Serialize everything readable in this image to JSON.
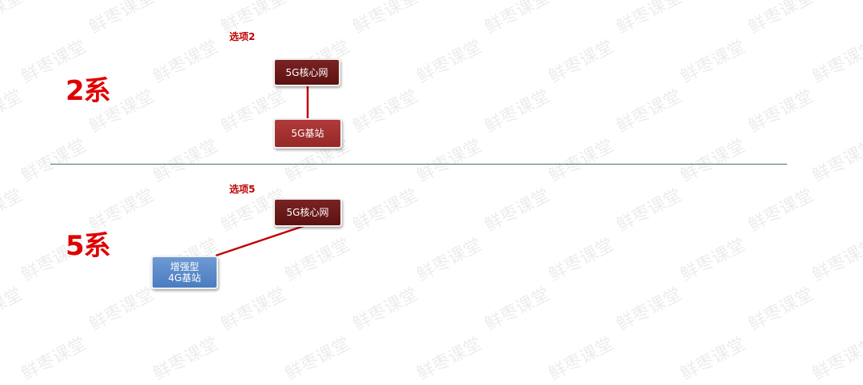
{
  "watermark": "鲜枣课堂",
  "top": {
    "option_label": "选项2",
    "section_label": "2系",
    "core_node": "5G核心网",
    "base_node": "5G基站"
  },
  "bottom": {
    "option_label": "选项5",
    "section_label": "5系",
    "core_node": "5G核心网",
    "base_node_line1": "增强型",
    "base_node_line2": "4G基站"
  },
  "colors": {
    "section_label": "#e00000",
    "core_node": "#6b1a1a",
    "base_node": "#a33030",
    "blue_node": "#5b8ac9",
    "link": "#c00000",
    "divider": "#3f7373"
  }
}
